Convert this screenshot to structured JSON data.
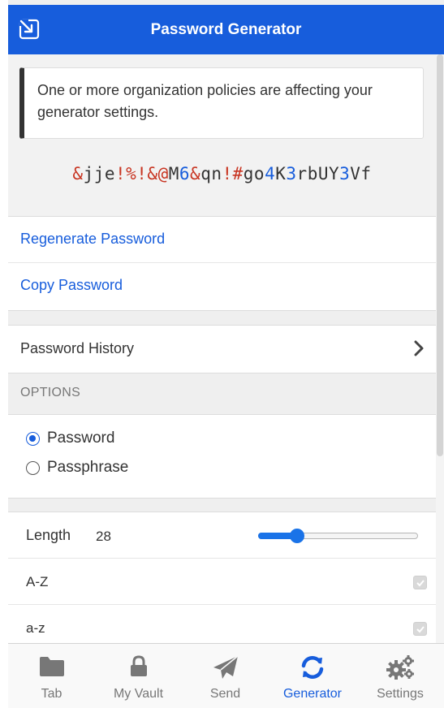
{
  "header": {
    "title": "Password Generator",
    "back_icon": "popout-icon"
  },
  "callout": {
    "message": "One or more organization policies are affecting your generator settings."
  },
  "generated_password": [
    {
      "t": "&",
      "k": "sp"
    },
    {
      "t": "jje",
      "k": "ch"
    },
    {
      "t": "!%!&@",
      "k": "sp"
    },
    {
      "t": "M",
      "k": "ch"
    },
    {
      "t": "6",
      "k": "num"
    },
    {
      "t": "&",
      "k": "sp"
    },
    {
      "t": "qn",
      "k": "ch"
    },
    {
      "t": "!#",
      "k": "sp"
    },
    {
      "t": "go",
      "k": "ch"
    },
    {
      "t": "4",
      "k": "num"
    },
    {
      "t": "K",
      "k": "ch"
    },
    {
      "t": "3",
      "k": "num"
    },
    {
      "t": "rbUY",
      "k": "ch"
    },
    {
      "t": "3",
      "k": "num"
    },
    {
      "t": "Vf",
      "k": "ch"
    }
  ],
  "actions": {
    "regenerate": "Regenerate Password",
    "copy": "Copy Password"
  },
  "history": {
    "label": "Password History",
    "chevron_icon": "chevron-right-icon"
  },
  "options": {
    "header": "OPTIONS",
    "type_password": "Password",
    "type_passphrase": "Passphrase",
    "selected_type": "password"
  },
  "settings": {
    "length_label": "Length",
    "length_value": "28",
    "length_fraction": 0.22,
    "uppercase_label": "A-Z",
    "uppercase_checked": true,
    "lowercase_label": "a-z",
    "lowercase_checked": true
  },
  "tabs": [
    {
      "label": "Tab",
      "icon": "folder-icon",
      "active": false
    },
    {
      "label": "My Vault",
      "icon": "lock-icon",
      "active": false
    },
    {
      "label": "Send",
      "icon": "send-icon",
      "active": false
    },
    {
      "label": "Generator",
      "icon": "refresh-icon",
      "active": true
    },
    {
      "label": "Settings",
      "icon": "cogs-icon",
      "active": false
    }
  ],
  "colors": {
    "brand": "#175ddc",
    "special_char": "#c83522",
    "number_char": "#175ddc"
  }
}
